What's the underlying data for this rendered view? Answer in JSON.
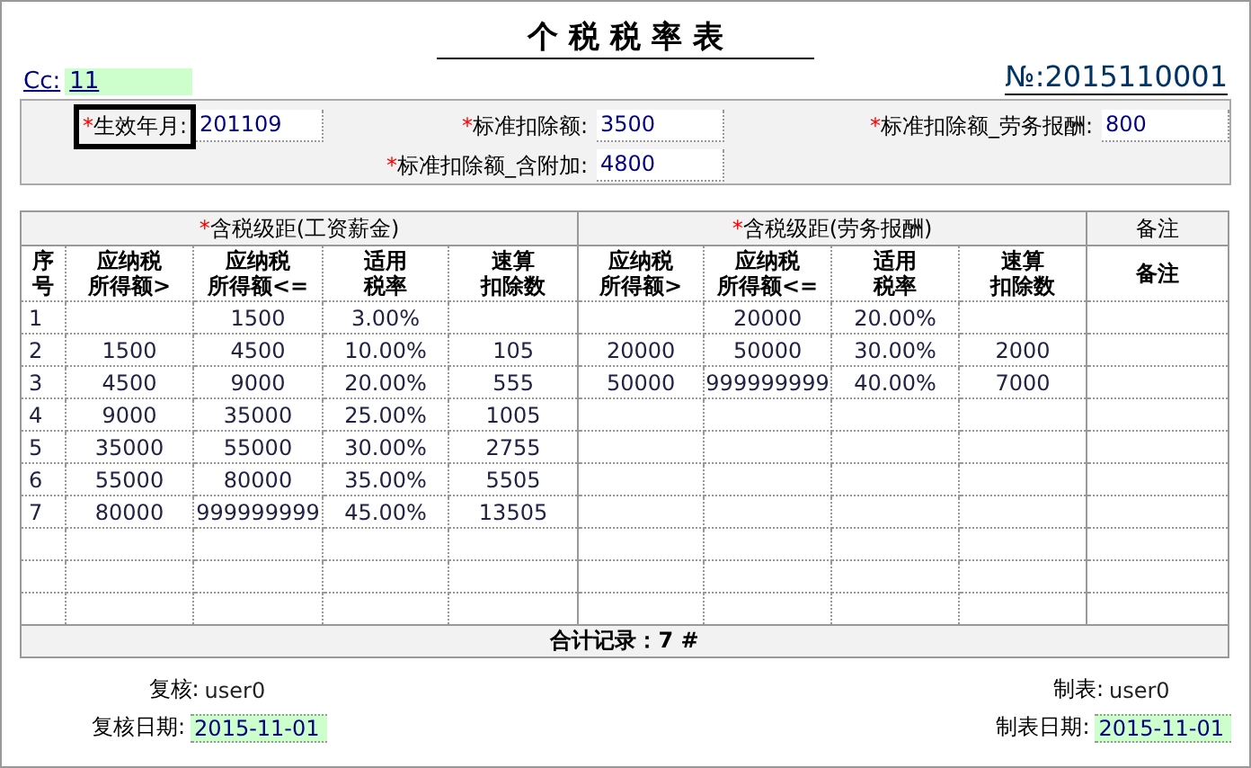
{
  "title": "个 税 税 率 表",
  "cc": {
    "label": "Cc:",
    "value": "11"
  },
  "number": "№:2015110001",
  "form": [
    {
      "mark": "*",
      "label": "生效年月:",
      "value": "201109",
      "focused": true
    },
    {
      "mark": "*",
      "label": "标准扣除额:",
      "value": "3500",
      "focused": false
    },
    {
      "mark": "*",
      "label": "标准扣除额_劳务报酬:",
      "value": "800",
      "focused": false
    },
    {
      "mark": "*",
      "label": "标准扣除额_含附加:",
      "value": "4800",
      "focused": false
    }
  ],
  "table": {
    "groups": [
      {
        "mark": "*",
        "label": "含税级距(工资薪金)"
      },
      {
        "mark": "*",
        "label": "含税级距(劳务报酬)"
      },
      {
        "label": "备注"
      }
    ],
    "columns": [
      {
        "lines": [
          "序",
          "号"
        ]
      },
      {
        "lines": [
          "应纳税",
          "所得额>"
        ]
      },
      {
        "lines": [
          "应纳税",
          "所得额<="
        ]
      },
      {
        "lines": [
          "适用",
          "税率"
        ]
      },
      {
        "lines": [
          "速算",
          "扣除数"
        ]
      },
      {
        "lines": [
          "应纳税",
          "所得额>"
        ]
      },
      {
        "lines": [
          "应纳税",
          "所得额<="
        ]
      },
      {
        "lines": [
          "适用",
          "税率"
        ]
      },
      {
        "lines": [
          "速算",
          "扣除数"
        ]
      },
      {
        "lines": [
          "备注"
        ]
      }
    ],
    "rows": [
      [
        "1",
        null,
        "1500",
        "3.00%",
        null,
        null,
        "20000",
        "20.00%",
        null,
        null
      ],
      [
        "2",
        "1500",
        "4500",
        "10.00%",
        "105",
        "20000",
        "50000",
        "30.00%",
        "2000",
        null
      ],
      [
        "3",
        "4500",
        "9000",
        "20.00%",
        "555",
        "50000",
        "999999999",
        "40.00%",
        "7000",
        null
      ],
      [
        "4",
        "9000",
        "35000",
        "25.00%",
        "1005",
        null,
        null,
        null,
        null,
        null
      ],
      [
        "5",
        "35000",
        "55000",
        "30.00%",
        "2755",
        null,
        null,
        null,
        null,
        null
      ],
      [
        "6",
        "55000",
        "80000",
        "35.00%",
        "5505",
        null,
        null,
        null,
        null,
        null
      ],
      [
        "7",
        "80000",
        "999999999",
        "45.00%",
        "13505",
        null,
        null,
        null,
        null,
        null
      ]
    ],
    "total": "合计记录：7 #"
  },
  "footer": {
    "left": [
      {
        "label": "复核:",
        "value": "user0",
        "kind": "text"
      },
      {
        "label": "复核日期:",
        "value": "2015-11-01",
        "kind": "date"
      }
    ],
    "right": [
      {
        "label": "制表:",
        "value": "user0",
        "kind": "text"
      },
      {
        "label": "制表日期:",
        "value": "2015-11-01",
        "kind": "date"
      }
    ]
  }
}
